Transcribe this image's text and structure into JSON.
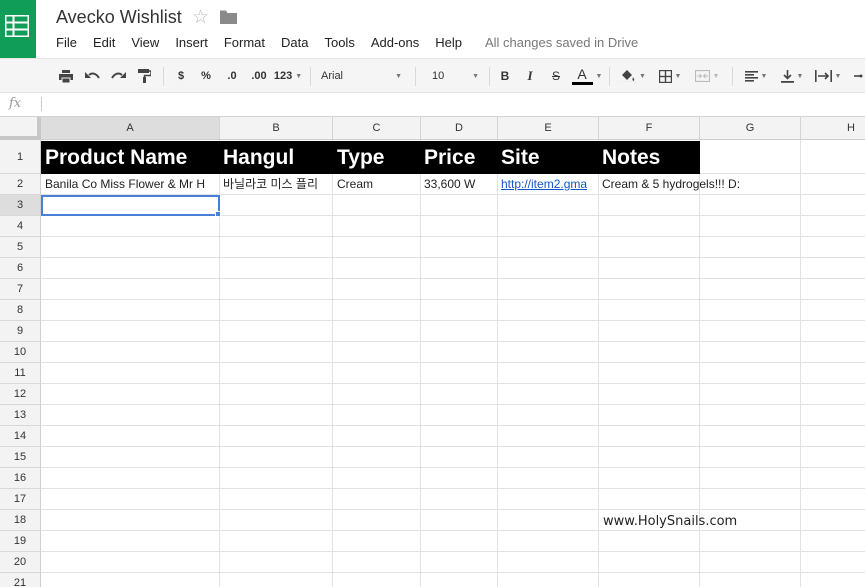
{
  "title": "Avecko Wishlist",
  "menu": [
    "File",
    "Edit",
    "View",
    "Insert",
    "Format",
    "Data",
    "Tools",
    "Add-ons",
    "Help"
  ],
  "save_status": "All changes saved in Drive",
  "toolbar": {
    "currency": "$",
    "percent": "%",
    "decrease_decimals": ".0",
    "increase_decimals": ".00",
    "more_formats": "123",
    "font": "Arial",
    "font_size": "10",
    "bold": "B",
    "italic": "I",
    "strike": "S",
    "text_color_label": "A",
    "text_color": "#000000"
  },
  "formula_bar": {
    "label": "fx",
    "value": ""
  },
  "columns": [
    "A",
    "B",
    "C",
    "D",
    "E",
    "F",
    "G",
    "H"
  ],
  "rows": [
    "1",
    "2",
    "3",
    "4",
    "5",
    "6",
    "7",
    "8",
    "9",
    "10",
    "11",
    "12",
    "13",
    "14",
    "15",
    "16",
    "17",
    "18",
    "19",
    "20",
    "21"
  ],
  "header_row": [
    "Product Name",
    "Hangul",
    "Type",
    "Price",
    "Site",
    "Notes"
  ],
  "data_row": {
    "product": "Banila Co Miss Flower & Mr H",
    "hangul": "바닐라코 미스 플리",
    "type": "Cream",
    "price": "33,600 W",
    "site": "http://item2.gma",
    "notes": "Cream & 5 hydrogels!!!  D:"
  },
  "active_cell": "A3",
  "watermark": "www.HolySnails.com",
  "colors": {
    "brand": "#0f9d58",
    "header_band": "#000000",
    "selection": "#4a7fd9",
    "link": "#1155cc"
  }
}
